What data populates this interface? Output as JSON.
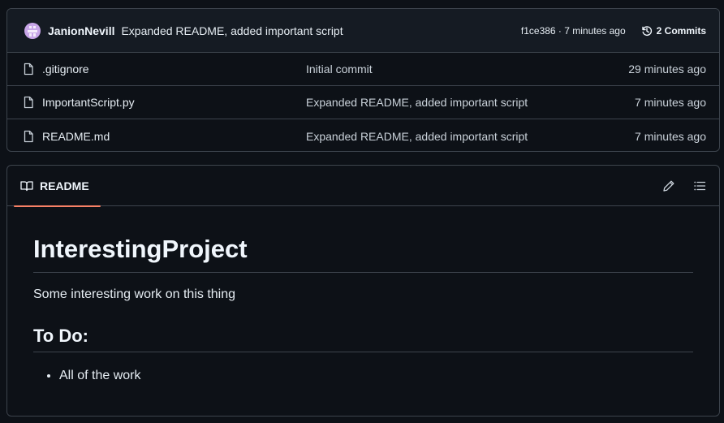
{
  "latest_commit": {
    "author": "JanionNevill",
    "message": "Expanded README, added important script",
    "sha_time": "f1ce386 · 7 minutes ago",
    "commits_label": "2 Commits"
  },
  "files": [
    {
      "name": ".gitignore",
      "commit": "Initial commit",
      "time": "29 minutes ago"
    },
    {
      "name": "ImportantScript.py",
      "commit": "Expanded README, added important script",
      "time": "7 minutes ago"
    },
    {
      "name": "README.md",
      "commit": "Expanded README, added important script",
      "time": "7 minutes ago"
    }
  ],
  "readme": {
    "tab_label": "README",
    "title": "InterestingProject",
    "paragraph": "Some interesting work on this thing",
    "subheading": "To Do:",
    "list": [
      "All of the work"
    ]
  },
  "icons": {
    "file": "file-icon",
    "history": "history-icon",
    "book": "book-icon",
    "edit": "pencil-icon",
    "outline": "list-icon"
  },
  "colors": {
    "background": "#0d1117",
    "header": "#151b23",
    "border": "#3d444d",
    "tab_underline": "#f78166"
  }
}
